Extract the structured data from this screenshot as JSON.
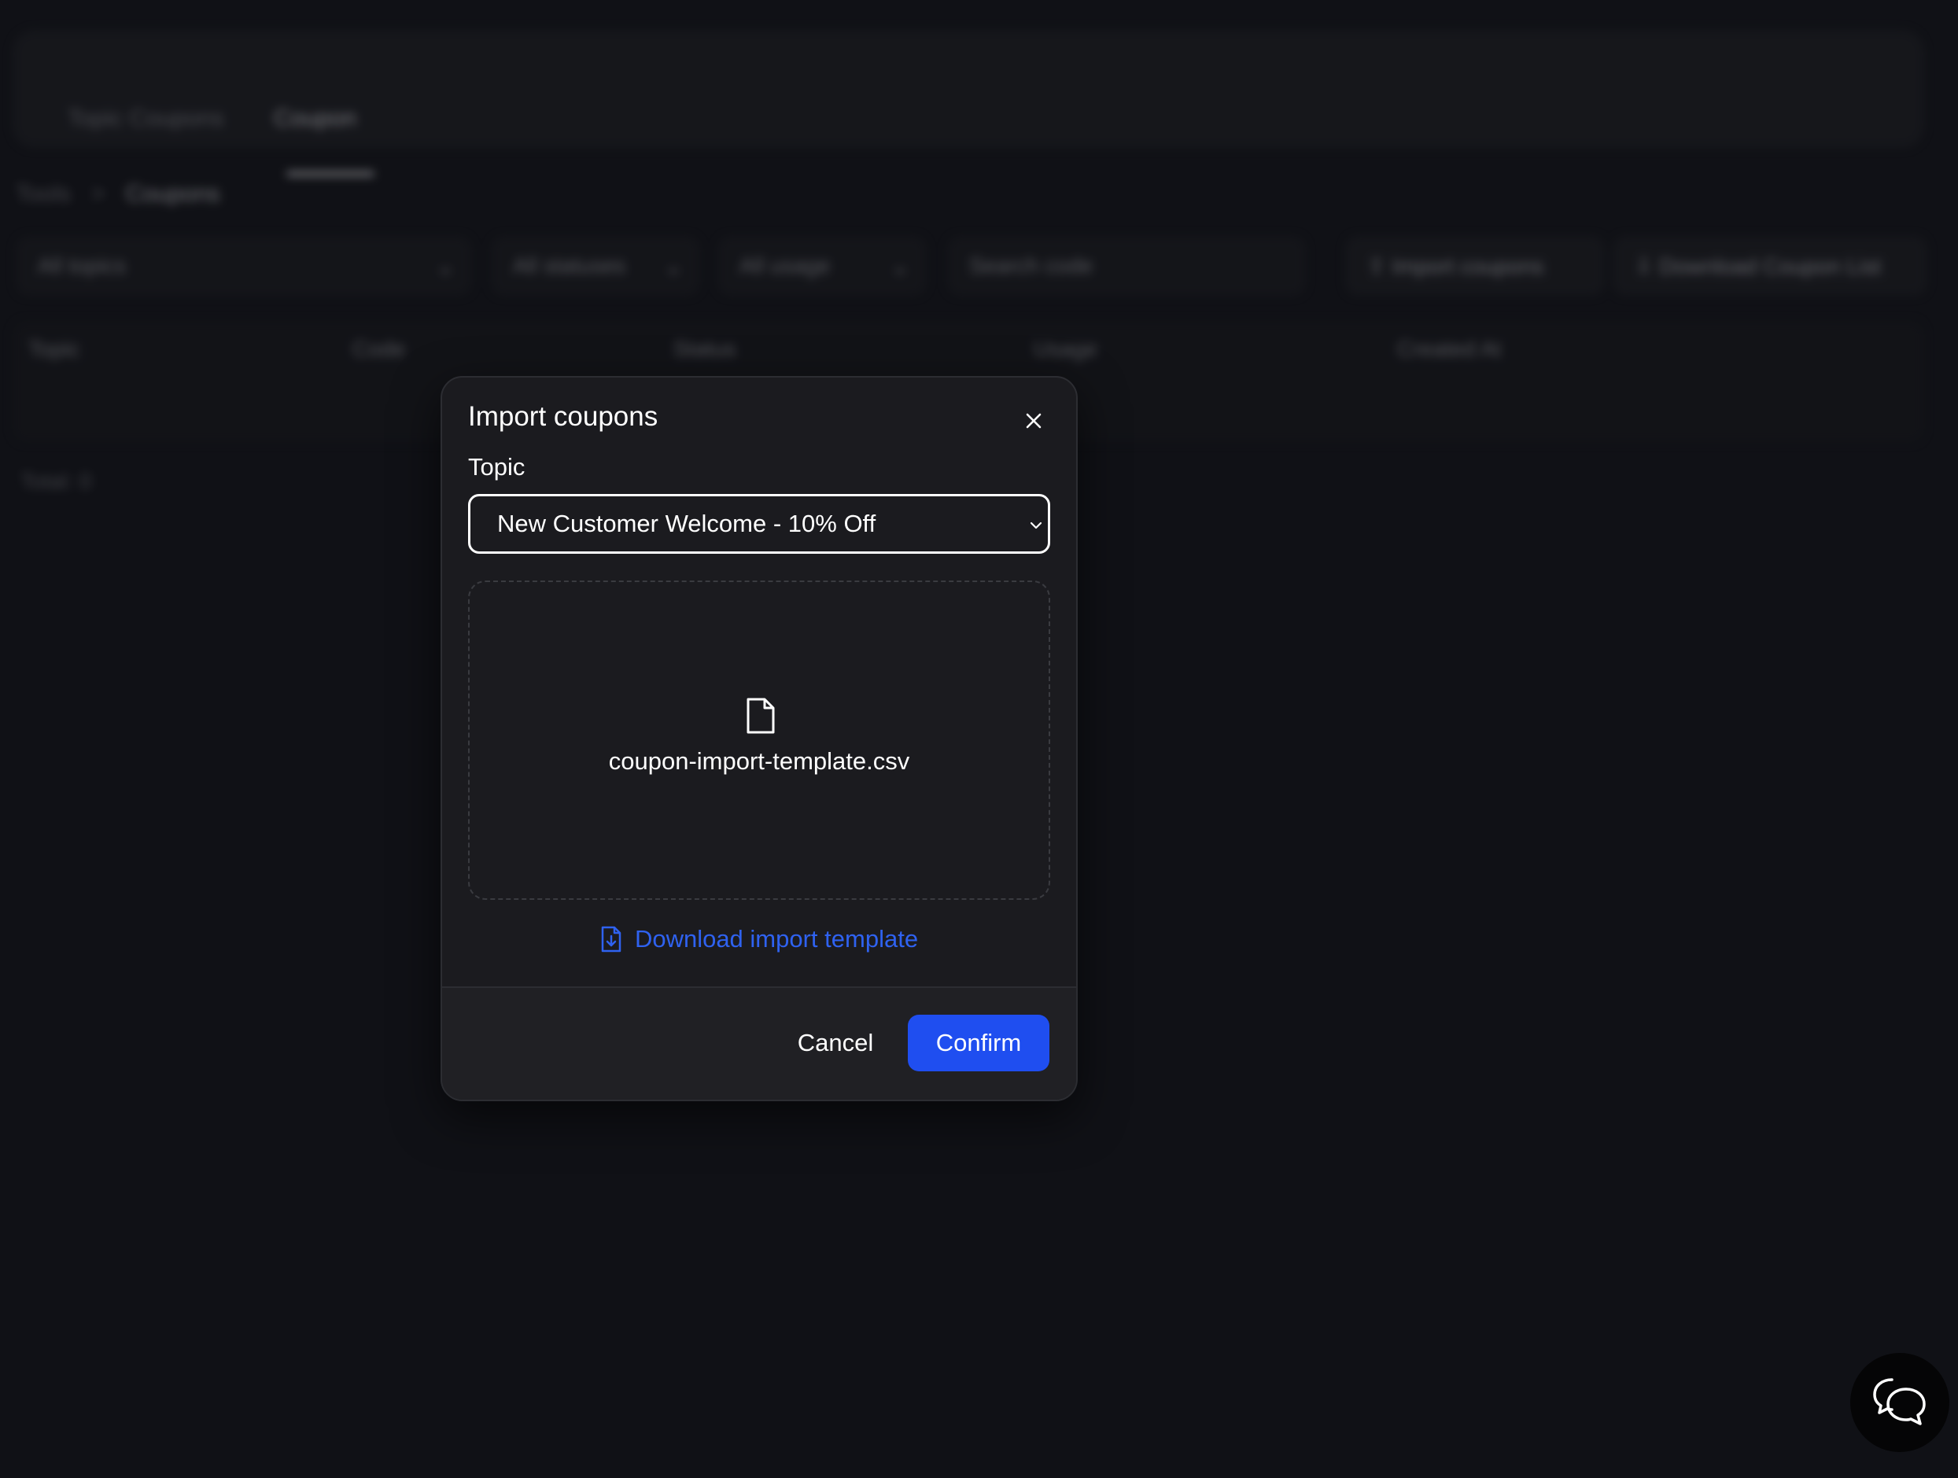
{
  "background": {
    "tabs": [
      {
        "label": "Topic Coupons"
      },
      {
        "label": "Coupon"
      }
    ],
    "breadcrumb": {
      "root": "Tools",
      "separator": ">",
      "current": "Coupons"
    },
    "filters": {
      "topic": "All topics",
      "status": "All statuses",
      "usage": "All usage",
      "search_placeholder": "Search code"
    },
    "buttons": {
      "import": "Import coupons",
      "download": "Download Coupon List"
    },
    "table_headers": [
      "Topic",
      "Code",
      "Status",
      "Usage",
      "Created At"
    ],
    "total": "Total: 0"
  },
  "modal": {
    "title": "Import coupons",
    "field_label": "Topic",
    "selected_topic": "New Customer Welcome - 10% Off",
    "file_name": "coupon-import-template.csv",
    "template_link": "Download import template",
    "cancel": "Cancel",
    "confirm": "Confirm"
  },
  "colors": {
    "accent": "#1f4ef0",
    "link": "#2f62f0",
    "page_bg": "#101116",
    "modal_bg": "#1b1b1f"
  },
  "icons": {
    "close": "close-icon",
    "file": "file-icon",
    "download_file": "file-download-icon",
    "chat": "chat-bubbles-icon"
  }
}
